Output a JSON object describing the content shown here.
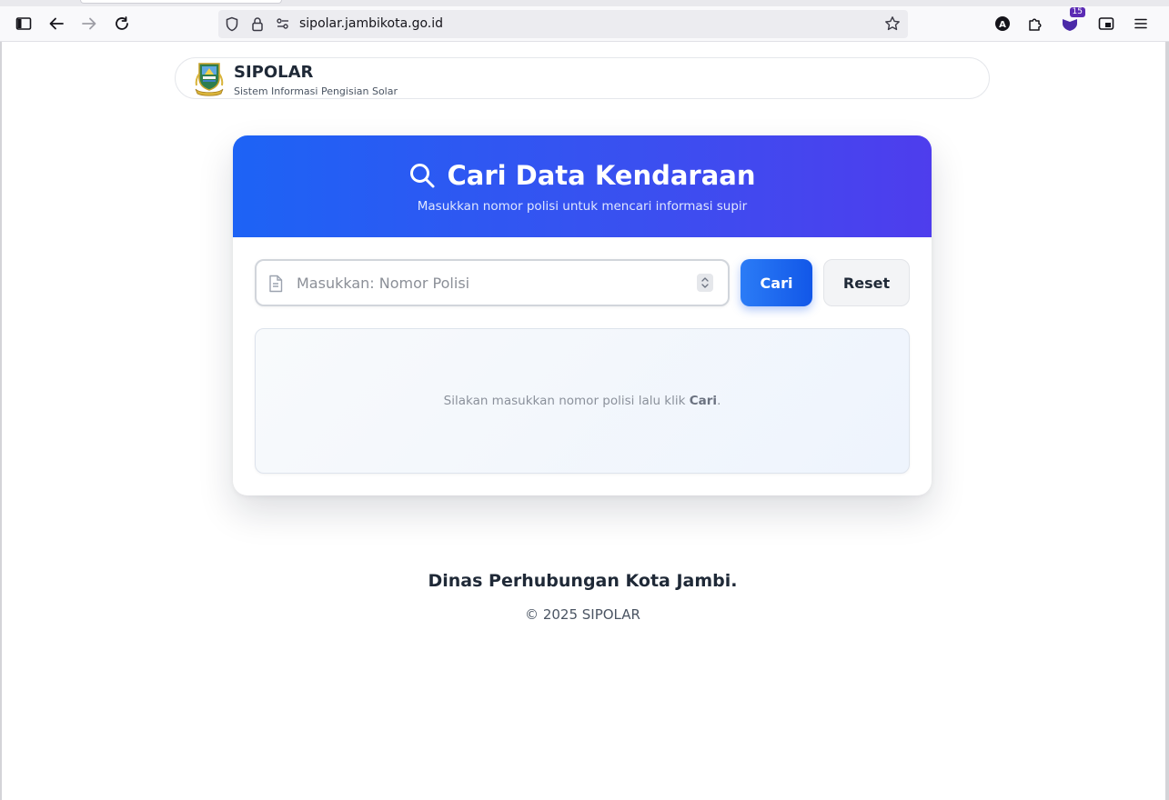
{
  "browser": {
    "url": "sipolar.jambikota.go.id",
    "extension_badge_count": "15"
  },
  "site": {
    "title": "SIPOLAR",
    "subtitle": "Sistem Informasi Pengisian Solar"
  },
  "search_card": {
    "title": "Cari Data Kendaraan",
    "subtitle": "Masukkan nomor polisi untuk mencari informasi supir",
    "input_placeholder": "Masukkan: Nomor Polisi",
    "input_value": "",
    "search_button": "Cari",
    "reset_button": "Reset",
    "result_hint_prefix": "Silakan masukkan nomor polisi lalu klik ",
    "result_hint_strong": "Cari",
    "result_hint_suffix": "."
  },
  "footer": {
    "agency": "Dinas Perhubungan Kota Jambi.",
    "copyright": "© 2025 SIPOLAR"
  },
  "colors": {
    "header_gradient_start": "#1d63f5",
    "header_gradient_end": "#4e3ded",
    "primary_button": "#1257e8"
  }
}
